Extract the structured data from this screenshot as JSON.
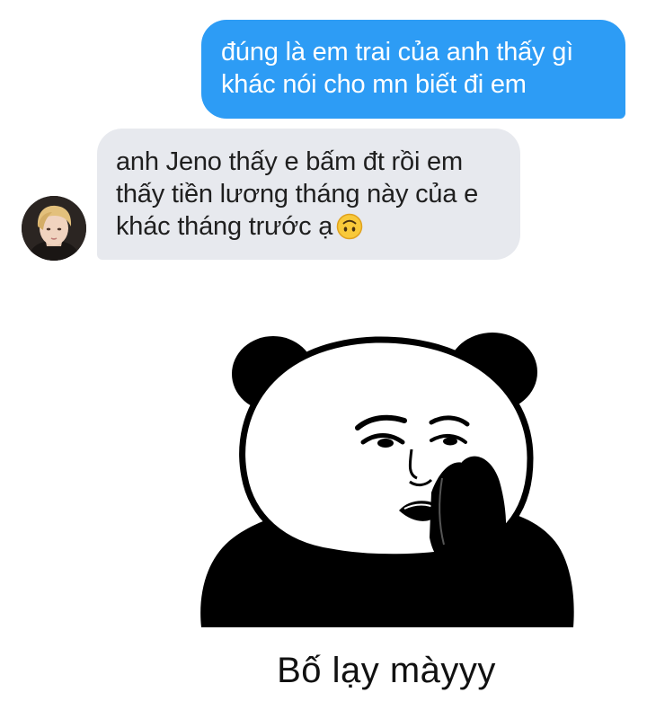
{
  "messages": {
    "sent": {
      "lines": [
        "đúng là em trai của anh thấy gì",
        "khác nói cho mn biết đi em"
      ],
      "bubble_color": "#2d9cf5",
      "text_color": "#ffffff"
    },
    "received": {
      "lines": [
        "anh Jeno thấy e bấm đt rồi em",
        "thấy tiền lương tháng này của e",
        "khác tháng trước ạ"
      ],
      "emoji": "upside-down-face-icon",
      "bubble_color": "#e7e9ee",
      "text_color": "#1f1f1f"
    }
  },
  "avatar": {
    "icon": "contact-avatar"
  },
  "sticker": {
    "icon": "panda-meme-praying-icon",
    "caption": "Bố lạy màyyy"
  }
}
